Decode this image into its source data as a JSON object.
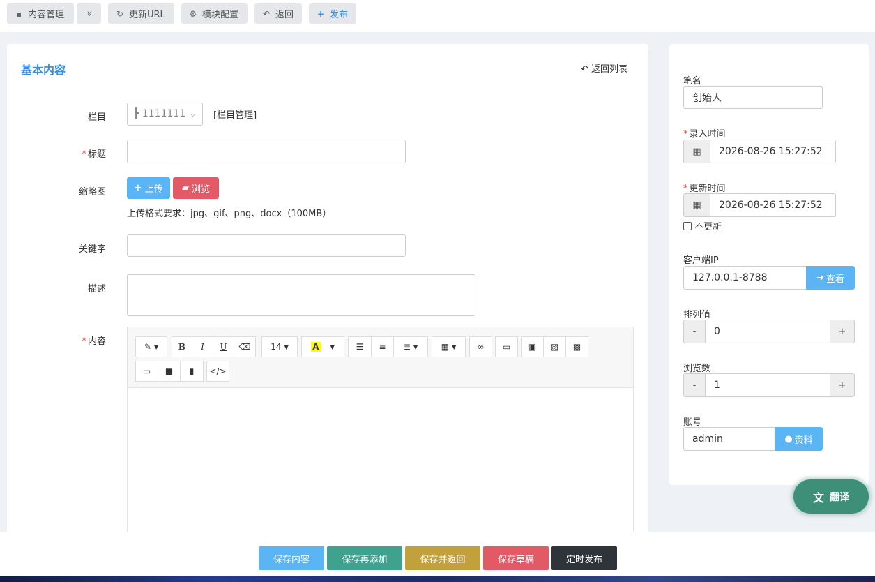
{
  "toolbar": {
    "content_manage": "内容管理",
    "more": "»",
    "update_url": "更新URL",
    "module_config": "模块配置",
    "back": "返回",
    "publish": "发布"
  },
  "main": {
    "title": "基本内容",
    "back_to_list": "返回列表",
    "fields": {
      "category_label": "栏目",
      "category_value": "┣ 1111111",
      "category_manage": "[栏目管理]",
      "title_label": "标题",
      "thumb_label": "缩略图",
      "upload_btn": "上传",
      "browse_btn": "浏览",
      "upload_hint": "上传格式要求：jpg、gif、png、docx（100MB）",
      "keywords_label": "关键字",
      "desc_label": "描述",
      "content_label": "内容"
    },
    "editor": {
      "font_size": "14"
    }
  },
  "side": {
    "pen_name_label": "笔名",
    "pen_name_value": "创始人",
    "input_time_label": "录入时间",
    "input_time_value": "2026-08-26 15:27:52",
    "update_time_label": "更新时间",
    "update_time_value": "2026-08-26 15:27:52",
    "no_update": "不更新",
    "client_ip_label": "客户端IP",
    "client_ip_value": "127.0.0.1-8788",
    "view_btn": "查看",
    "order_label": "排列值",
    "order_value": "0",
    "hits_label": "浏览数",
    "hits_value": "1",
    "account_label": "账号",
    "account_value": "admin",
    "profile_btn": "资料",
    "minus": "-",
    "plus": "+"
  },
  "translate": "翻译",
  "bottom": {
    "save": "保存内容",
    "save_add": "保存再添加",
    "save_back": "保存并返回",
    "save_draft": "保存草稿",
    "timed_publish": "定时发布"
  },
  "colors": {
    "accent": "#3a8ee6",
    "save": "#5bb5f5",
    "save_add": "#3fa28f",
    "save_back": "#c2a13c",
    "save_draft": "#e25a65",
    "timed": "#2f343a"
  }
}
